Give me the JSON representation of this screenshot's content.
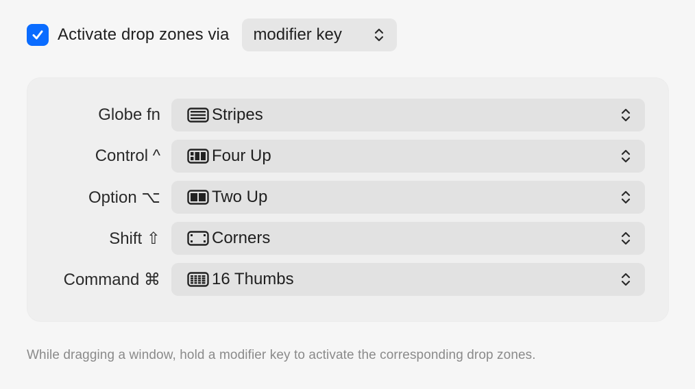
{
  "activation": {
    "checked": true,
    "label": "Activate drop zones via",
    "selected": "modifier key"
  },
  "modifiers": [
    {
      "label": "Globe fn",
      "value": "Stripes",
      "icon": "stripes-icon"
    },
    {
      "label": "Control ^",
      "value": "Four Up",
      "icon": "four-up-icon"
    },
    {
      "label": "Option ⌥",
      "value": "Two Up",
      "icon": "two-up-icon"
    },
    {
      "label": "Shift ⇧",
      "value": "Corners",
      "icon": "corners-icon"
    },
    {
      "label": "Command ⌘",
      "value": "16 Thumbs",
      "icon": "sixteen-thumbs-icon"
    }
  ],
  "footer": {
    "hint": "While dragging a window, hold a modifier key to activate the corresponding drop zones."
  },
  "colors": {
    "accent": "#0a6cff",
    "background": "#f6f6f6",
    "select_bg": "#e2e2e2"
  }
}
